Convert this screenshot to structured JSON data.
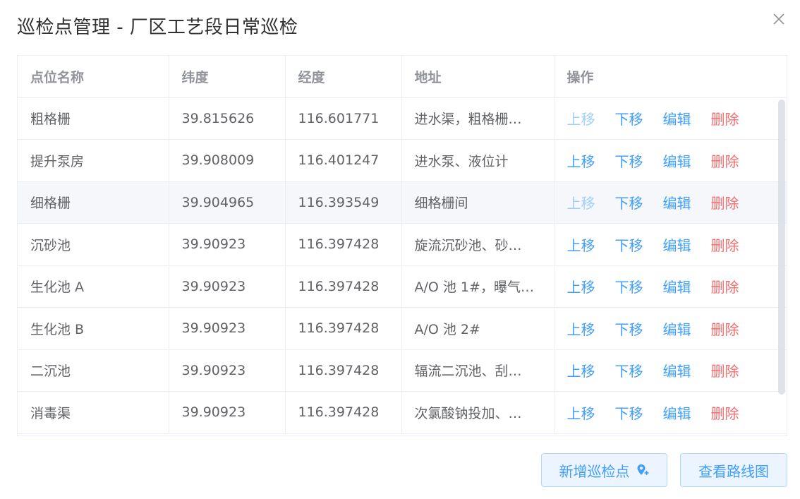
{
  "dialog": {
    "title": "巡检点管理 - 厂区工艺段日常巡检"
  },
  "table": {
    "headers": [
      "点位名称",
      "纬度",
      "经度",
      "地址",
      "操作"
    ],
    "rows": [
      {
        "name": "粗格栅",
        "lat": "39.815626",
        "lng": "116.601771",
        "addr": "进水渠，粗格栅…",
        "up_disabled": true
      },
      {
        "name": "提升泵房",
        "lat": "39.908009",
        "lng": "116.401247",
        "addr": "进水泵、液位计",
        "up_disabled": false
      },
      {
        "name": "细格栅",
        "lat": "39.904965",
        "lng": "116.393549",
        "addr": "细格栅间",
        "up_disabled": true
      },
      {
        "name": "沉砂池",
        "lat": "39.90923",
        "lng": "116.397428",
        "addr": "旋流沉砂池、砂…",
        "up_disabled": false
      },
      {
        "name": "生化池 A",
        "lat": "39.90923",
        "lng": "116.397428",
        "addr": "A/O 池 1#，曝气…",
        "up_disabled": false
      },
      {
        "name": "生化池 B",
        "lat": "39.90923",
        "lng": "116.397428",
        "addr": "A/O 池 2#",
        "up_disabled": false
      },
      {
        "name": "二沉池",
        "lat": "39.90923",
        "lng": "116.397428",
        "addr": "辐流二沉池、刮…",
        "up_disabled": false
      },
      {
        "name": "消毒渠",
        "lat": "39.90923",
        "lng": "116.397428",
        "addr": "次氯酸钠投加、…",
        "up_disabled": false
      }
    ],
    "actions": {
      "up": "上移",
      "down": "下移",
      "edit": "编辑",
      "delete": "删除"
    }
  },
  "footer": {
    "add_label": "新增巡检点",
    "route_label": "查看路线图"
  },
  "colors": {
    "primary": "#409eff",
    "primary_disabled": "#a0cfff",
    "danger": "#f56c6c",
    "button_bg": "#ecf5ff"
  },
  "icons": {
    "close": "close-icon",
    "add_location": "map-pin-plus-icon"
  }
}
